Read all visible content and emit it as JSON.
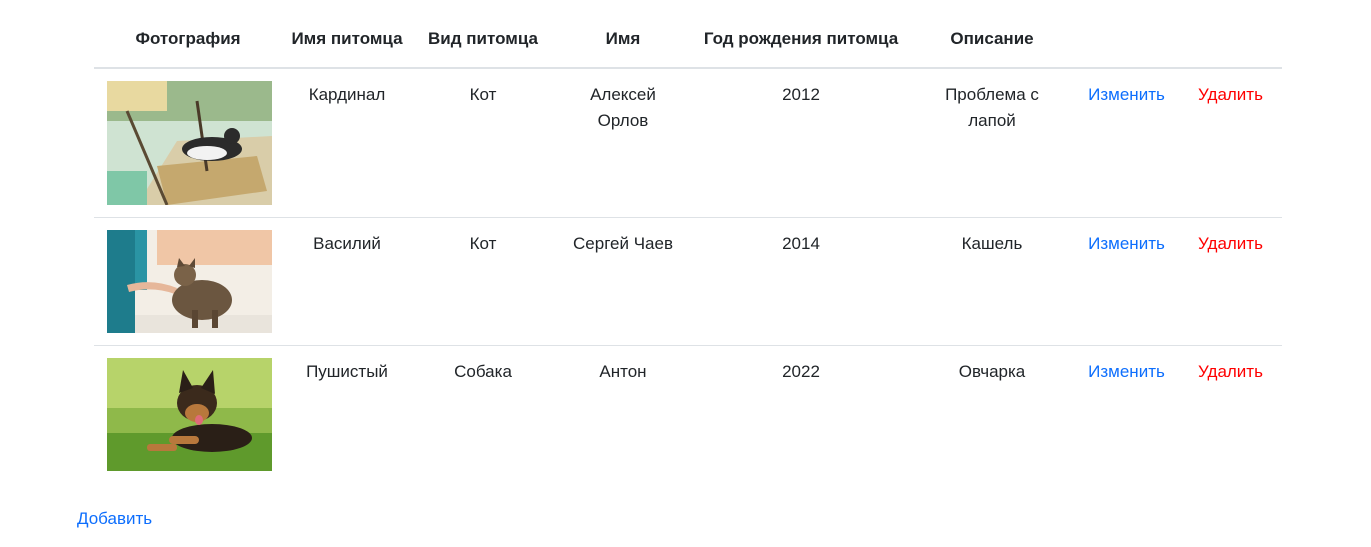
{
  "table": {
    "headers": {
      "photo": "Фотография",
      "pet_name": "Имя питомца",
      "pet_kind": "Вид питомца",
      "owner_name": "Имя",
      "birth_year": "Год рождения питомца",
      "description": "Описание"
    },
    "rows": [
      {
        "pet_name": "Кардинал",
        "pet_kind": "Кот",
        "owner_name": "Алексей Орлов",
        "birth_year": "2012",
        "description": "Проблема с лапой",
        "edit_label": "Изменить",
        "delete_label": "Удалить"
      },
      {
        "pet_name": "Василий",
        "pet_kind": "Кот",
        "owner_name": "Сергей Чаев",
        "birth_year": "2014",
        "description": "Кашель",
        "edit_label": "Изменить",
        "delete_label": "Удалить"
      },
      {
        "pet_name": "Пушистый",
        "pet_kind": "Собака",
        "owner_name": "Антон",
        "birth_year": "2022",
        "description": "Овчарка",
        "edit_label": "Изменить",
        "delete_label": "Удалить"
      }
    ]
  },
  "add_label": "Добавить",
  "colors": {
    "link": "#0d6efd",
    "danger": "#ff0000",
    "text": "#212529",
    "border": "#dee2e6"
  }
}
